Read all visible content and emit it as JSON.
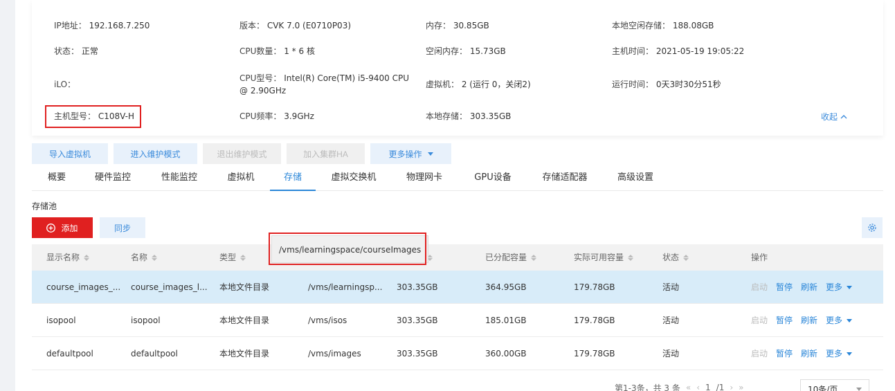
{
  "info": {
    "ip_label": "IP地址：",
    "ip_value": "192.168.7.250",
    "version_label": "版本：",
    "version_value": "CVK 7.0 (E0710P03)",
    "memory_label": "内存：",
    "memory_value": "30.85GB",
    "local_free_label": "本地空闲存储：",
    "local_free_value": "188.08GB",
    "status_label": "状态：",
    "status_value": "正常",
    "cpu_count_label": "CPU数量：",
    "cpu_count_value": "1 * 6 核",
    "free_mem_label": "空闲内存：",
    "free_mem_value": "15.73GB",
    "host_time_label": "主机时间：",
    "host_time_value": "2021-05-19 19:05:22",
    "ilo_label": "iLO：",
    "ilo_value": "",
    "cpu_model_label": "CPU型号：",
    "cpu_model_value_1": "Intel(R) Core(TM) i5-9400 CPU",
    "cpu_model_value_2": "@ 2.90GHz",
    "vm_label": "虚拟机：",
    "vm_value": "2 (运行 0，关闭2)",
    "uptime_label": "运行时间：",
    "uptime_value": "0天3时30分51秒",
    "host_model_label": "主机型号：",
    "host_model_value": "C108V-H",
    "cpu_freq_label": "CPU频率：",
    "cpu_freq_value": "3.9GHz",
    "local_storage_label": "本地存储：",
    "local_storage_value": "303.35GB",
    "collapse_label": "收起"
  },
  "actions": {
    "import_vm": "导入虚拟机",
    "enter_maint": "进入维护模式",
    "exit_maint": "退出维护模式",
    "join_ha": "加入集群HA",
    "more_ops": "更多操作"
  },
  "tabs": [
    "概要",
    "硬件监控",
    "性能监控",
    "虚拟机",
    "存储",
    "虚拟交换机",
    "物理网卡",
    "GPU设备",
    "存储适配器",
    "高级设置"
  ],
  "storage": {
    "section_title": "存储池",
    "add_label": "添加",
    "sync_label": "同步",
    "tooltip": "/vms/learningspace/courseImages",
    "headers": [
      "显示名称",
      "名称",
      "类型",
      "",
      "",
      "已分配容量",
      "实际可用容量",
      "状态",
      "操作"
    ],
    "rows": [
      {
        "display": "course_images_...",
        "name": "course_images_l...",
        "type": "本地文件目录",
        "path": "/vms/learningsp...",
        "total": "303.35GB",
        "allocated": "364.95GB",
        "available": "179.78GB",
        "status": "活动"
      },
      {
        "display": "isopool",
        "name": "isopool",
        "type": "本地文件目录",
        "path": "/vms/isos",
        "total": "303.35GB",
        "allocated": "185.01GB",
        "available": "179.78GB",
        "status": "活动"
      },
      {
        "display": "defaultpool",
        "name": "defaultpool",
        "type": "本地文件目录",
        "path": "/vms/images",
        "total": "303.35GB",
        "allocated": "360.00GB",
        "available": "179.78GB",
        "status": "活动"
      }
    ],
    "ops": {
      "start": "启动",
      "pause": "暂停",
      "refresh": "刷新",
      "more": "更多"
    }
  },
  "pager": {
    "summary": "第1-3条，共 3 条",
    "page": "1",
    "total_pages": "/1",
    "page_size": "10条/页"
  },
  "colors": {
    "accent": "#2a86d8",
    "danger": "#e02020",
    "selected_row": "#d8ecf9"
  }
}
